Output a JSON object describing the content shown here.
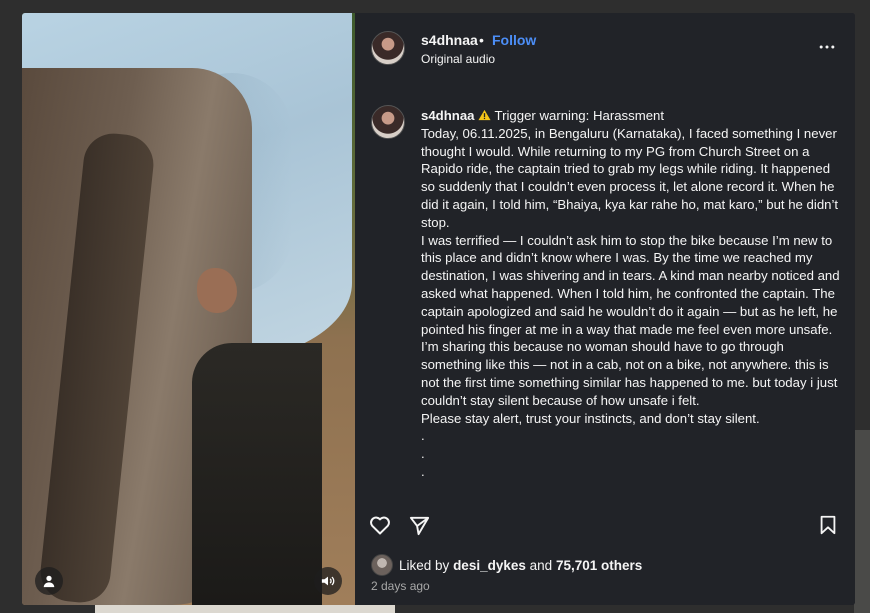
{
  "post": {
    "username": "s4dhnaa",
    "separator": "•",
    "follow_label": "Follow",
    "audio": "Original audio",
    "more_icon": "more-horizontal-icon"
  },
  "caption": {
    "username": "s4dhnaa",
    "warning_icon": "warning-icon",
    "first_line": "Trigger warning: Harassment",
    "paragraphs": [
      "Today, 06.11.2025, in Bengaluru (Karnataka), I faced something I never thought I would. While returning to my PG from Church Street on a Rapido ride, the captain tried to grab my legs while riding. It happened so suddenly that I couldn’t even process it, let alone record it. When he did it again, I told him, “Bhaiya, kya kar rahe ho, mat karo,” but he didn’t stop.",
      "I was terrified — I couldn’t ask him to stop the bike because I’m new to this place and didn’t know where I was. By the time we reached my destination, I was shivering and in tears. A kind man nearby noticed and asked what happened. When I told him, he confronted the captain. The captain apologized and said he wouldn’t do it again — but as he left, he pointed his finger at me in a way that made me feel even more unsafe.",
      "I’m sharing this because no woman should have to go through something like this — not in a cab, not on a bike, not anywhere. this is not the first time something similar has happened to me. but today i just couldn’t stay silent because of how unsafe i felt.",
      "Please stay alert, trust your instincts, and don’t stay silent."
    ],
    "dot_lines": [
      ".",
      ".",
      "."
    ]
  },
  "actions": {
    "like_icon": "heart-icon",
    "share_icon": "send-icon",
    "save_icon": "bookmark-icon"
  },
  "likes": {
    "prefix": "Liked by ",
    "user": "desi_dykes",
    "middle": " and ",
    "count": "75,701 others"
  },
  "timestamp": "2 days ago",
  "media": {
    "profile_icon": "user-icon",
    "sound_icon": "volume-icon"
  },
  "colors": {
    "panel_bg": "#212328",
    "accent": "#4c8ef7",
    "text": "#f5f5f5",
    "muted": "#a8a8a8"
  }
}
